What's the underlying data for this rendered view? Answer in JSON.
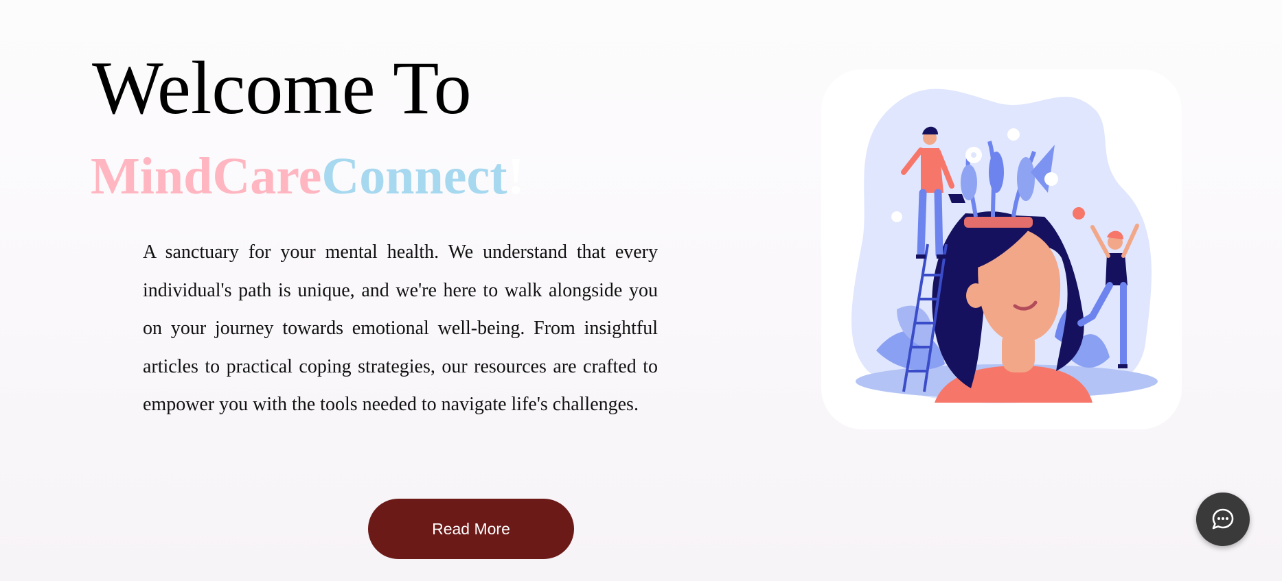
{
  "hero": {
    "welcome": "Welcome To",
    "brand_part1": "MindCare",
    "brand_part2": "Connect",
    "brand_exclaim": "!",
    "description": "A sanctuary for your mental health. We understand that every individual's path is unique, and we're here to walk alongside you on your journey towards emotional well-being. From insightful articles to practical coping strategies, our resources are crafted to empower you with the tools needed to navigate life's challenges.",
    "read_more_label": "Read More"
  },
  "illustration": {
    "icon": "mental-wellness-illustration"
  },
  "chat": {
    "icon": "chat-bubble-icon"
  },
  "colors": {
    "brand_pink": "#ffb6c1",
    "brand_blue": "#a6d8ef",
    "button_bg": "#6b1a18",
    "chat_bg": "#3a3a3a"
  }
}
